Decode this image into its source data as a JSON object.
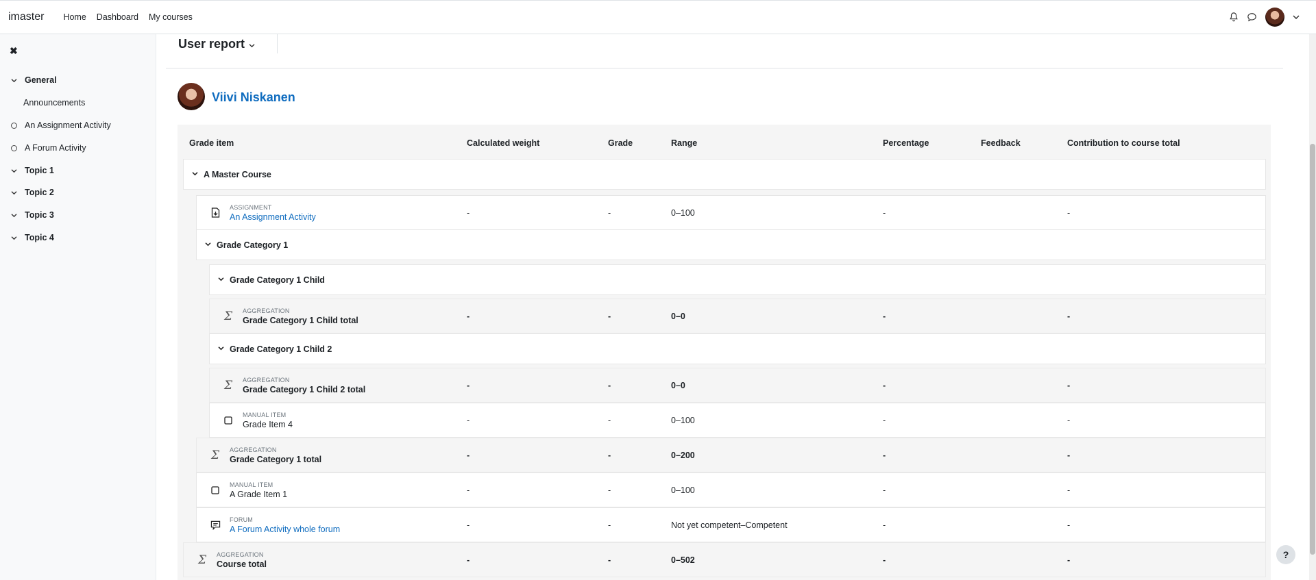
{
  "app": {
    "brand": "imaster",
    "nav": [
      "Home",
      "Dashboard",
      "My courses"
    ]
  },
  "sidebar": {
    "close_label": "✖",
    "items": [
      {
        "label": "General",
        "bold": true
      },
      {
        "label": "Announcements",
        "bold": false
      },
      {
        "label": "An Assignment Activity",
        "bold": false
      },
      {
        "label": "A Forum Activity",
        "bold": false
      },
      {
        "label": "Topic 1",
        "bold": true
      },
      {
        "label": "Topic 2",
        "bold": true
      },
      {
        "label": "Topic 3",
        "bold": true
      },
      {
        "label": "Topic 4",
        "bold": true
      }
    ]
  },
  "report": {
    "title": "User report",
    "user_name": "Viivi Niskanen"
  },
  "table": {
    "headers": [
      "Grade item",
      "Calculated weight",
      "Grade",
      "Range",
      "Percentage",
      "Feedback",
      "Contribution to course total"
    ],
    "course_title": "A Master Course",
    "rows": {
      "assignment": {
        "type": "ASSIGNMENT",
        "name": "An Assignment Activity",
        "weight": "-",
        "grade": "-",
        "range": "0–100",
        "percentage": "-",
        "contribution": "-"
      },
      "cat1": {
        "title": "Grade Category 1"
      },
      "cat1child": {
        "title": "Grade Category 1 Child"
      },
      "cat1child_total": {
        "type": "AGGREGATION",
        "name": "Grade Category 1 Child total",
        "weight": "-",
        "grade": "-",
        "range": "0–0",
        "percentage": "-",
        "contribution": "-"
      },
      "cat1child2": {
        "title": "Grade Category 1 Child 2"
      },
      "cat1child2_total": {
        "type": "AGGREGATION",
        "name": "Grade Category 1 Child 2 total",
        "weight": "-",
        "grade": "-",
        "range": "0–0",
        "percentage": "-",
        "contribution": "-"
      },
      "item4": {
        "type": "MANUAL ITEM",
        "name": "Grade Item 4",
        "weight": "-",
        "grade": "-",
        "range": "0–100",
        "percentage": "-",
        "contribution": "-"
      },
      "cat1_total": {
        "type": "AGGREGATION",
        "name": "Grade Category 1 total",
        "weight": "-",
        "grade": "-",
        "range": "0–200",
        "percentage": "-",
        "contribution": "-"
      },
      "item1": {
        "type": "MANUAL ITEM",
        "name": "A Grade Item 1",
        "weight": "-",
        "grade": "-",
        "range": "0–100",
        "percentage": "-",
        "contribution": "-"
      },
      "forum": {
        "type": "FORUM",
        "name": "A Forum Activity whole forum",
        "weight": "-",
        "grade": "-",
        "range": "Not yet competent–Competent",
        "percentage": "-",
        "contribution": "-"
      },
      "course_total": {
        "type": "AGGREGATION",
        "name": "Course total",
        "weight": "-",
        "grade": "-",
        "range": "0–502",
        "percentage": "-",
        "contribution": "-"
      }
    }
  },
  "help_label": "?"
}
